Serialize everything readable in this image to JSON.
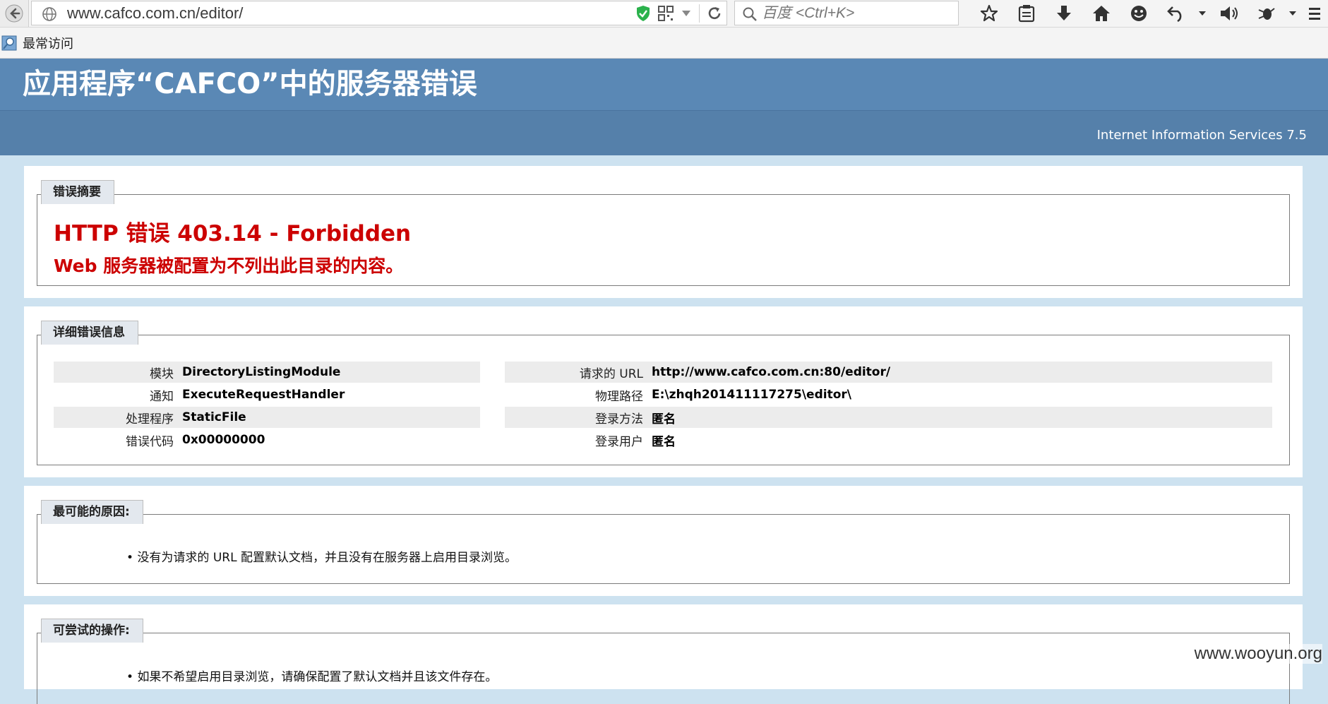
{
  "browser": {
    "url": "www.cafco.com.cn/editor/",
    "search_placeholder": "百度 <Ctrl+K>",
    "bookmarks": [
      {
        "label": "最常访问"
      }
    ]
  },
  "page": {
    "title": "应用程序“CAFCO”中的服务器错误",
    "server": "Internet Information Services 7.5",
    "summary": {
      "legend": "错误摘要",
      "code": "HTTP 错误 403.14 - Forbidden",
      "description": "Web 服务器被配置为不列出此目录的内容。"
    },
    "details": {
      "legend": "详细错误信息",
      "left": [
        {
          "label": "模块",
          "value": "DirectoryListingModule"
        },
        {
          "label": "通知",
          "value": "ExecuteRequestHandler"
        },
        {
          "label": "处理程序",
          "value": "StaticFile"
        },
        {
          "label": "错误代码",
          "value": "0x00000000"
        }
      ],
      "right": [
        {
          "label": "请求的 URL",
          "value": "http://www.cafco.com.cn:80/editor/"
        },
        {
          "label": "物理路径",
          "value": "E:\\zhqh201411117275\\editor\\"
        },
        {
          "label": "登录方法",
          "value": "匿名"
        },
        {
          "label": "登录用户",
          "value": "匿名"
        }
      ]
    },
    "causes": {
      "legend": "最可能的原因:",
      "items": [
        "没有为请求的 URL 配置默认文档，并且没有在服务器上启用目录浏览。"
      ]
    },
    "actions": {
      "legend": "可尝试的操作:",
      "items": [
        "如果不希望启用目录浏览，请确保配置了默认文档并且该文件存在。"
      ]
    }
  },
  "watermark": "www.wooyun.org",
  "colors": {
    "header": "#5a88b5",
    "subheader": "#5580aa",
    "background": "#cde2f0",
    "error_red": "#cc0000"
  }
}
